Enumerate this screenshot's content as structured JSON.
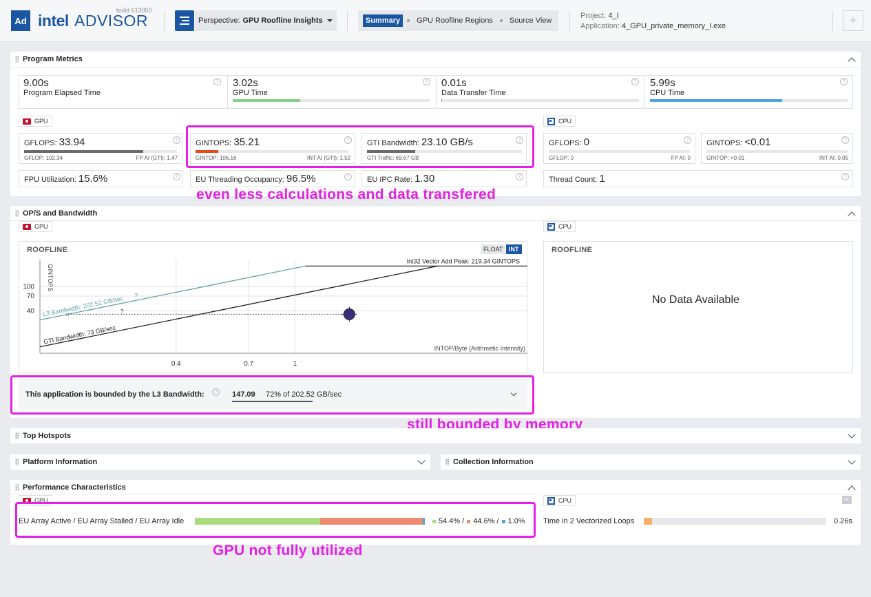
{
  "header": {
    "logo_badge": "Ad",
    "logo_brand": "intel",
    "logo_product": "ADVISOR",
    "build": "build 613050",
    "perspective_prefix": "Perspective:",
    "perspective_value": "GPU Roofline Insights",
    "tabs": [
      "Summary",
      "GPU Roofline Regions",
      "Source View"
    ],
    "project_label": "Project:",
    "project_value": "4_I",
    "application_label": "Application:",
    "application_value": "4_GPU_private_memory_I.exe",
    "add_button": "+"
  },
  "program_metrics": {
    "title": "Program Metrics",
    "top": [
      {
        "value": "9.00s",
        "label": "Program Elapsed Time",
        "fill": null,
        "color": null
      },
      {
        "value": "3.02s",
        "label": "GPU Time",
        "fill": 0.34,
        "color": "#8ad08a"
      },
      {
        "value": "0.01s",
        "label": "Data Transfer Time",
        "fill": 0.003,
        "color": "#e86a8a"
      },
      {
        "value": "5.99s",
        "label": "CPU Time",
        "fill": 0.67,
        "color": "#4ea6dc"
      }
    ],
    "gpu_chip": "GPU",
    "cpu_chip": "CPU",
    "gflops": {
      "label": "GFLOPS:",
      "value": "33.94",
      "sub_left": "GFLOP: 102.34",
      "sub_right": "FP AI (GTI): 1.47",
      "fill": 0.78
    },
    "gintops": {
      "label": "GINTOPS:",
      "value": "35.21",
      "sub_left": "GINTOP: 106.16",
      "sub_right": "INT AI (GTI): 1.52",
      "fill": 0.15
    },
    "gti": {
      "label": "GTI Bandwidth:",
      "value": "23.10 GB/s",
      "sub_left": "GTI Traffic: 69.67 GB",
      "fill": 0.31
    },
    "cpu_gflops": {
      "label": "GFLOPS:",
      "value": "0",
      "sub_left": "GFLOP: 0",
      "sub_right": "FP AI: 0"
    },
    "cpu_gintops": {
      "label": "GINTOPS:",
      "value": "<0.01",
      "sub_left": "GINTOP: <0.01",
      "sub_right": "INT AI: 0.05"
    },
    "fpu": {
      "label": "FPU Utilization:",
      "value": "15.6%"
    },
    "eu_occ": {
      "label": "EU Threading Occupancy:",
      "value": "96.5%"
    },
    "eu_ipc": {
      "label": "EU IPC Rate:",
      "value": "1.30"
    },
    "thread_count": {
      "label": "Thread Count:",
      "value": "1"
    }
  },
  "annotations": {
    "a1": "even less calculations and data transfered",
    "a2": "still bounded by memory",
    "a3": "GPU not fully utilized"
  },
  "ops_bandwidth": {
    "title": "OP/S and Bandwidth",
    "gpu_chip": "GPU",
    "cpu_chip": "CPU",
    "roofline_title": "ROOFLINE",
    "toggle_float": "FLOAT",
    "toggle_int": "INT",
    "cpu_roofline_title": "ROOFLINE",
    "no_data": "No Data Available",
    "bound_text": "This application is bounded by the L3 Bandwidth:",
    "bound_value": "147.09",
    "bound_pct": "72% of 202.52 GB/sec"
  },
  "chart_data": {
    "type": "scatter",
    "ylabel": "GINTOPS",
    "xlabel": "INTOP/Byte (Arithmetic Intensity)",
    "x_ticks": [
      "0.4",
      "0.7",
      "1"
    ],
    "y_ticks": [
      "100",
      "70",
      "40"
    ],
    "x_scale": "log",
    "y_scale": "log",
    "roofs": [
      {
        "name": "Int32 Vector Add Peak: 219.34 GINTOPS",
        "value": 219.34,
        "kind": "compute"
      },
      {
        "name": "L3 Bandwidth: 202.52 GB/sec",
        "value": 202.52,
        "kind": "memory"
      },
      {
        "name": "GTI Bandwidth: 73 GB/sec",
        "value": 73,
        "kind": "memory"
      }
    ],
    "points": [
      {
        "x": 1.52,
        "y": 35.21,
        "color": "#3b2d7a"
      }
    ],
    "roof_markers": [
      "?",
      "?"
    ]
  },
  "top_hotspots": {
    "title": "Top Hotspots"
  },
  "platform_info": {
    "title": "Platform Information"
  },
  "collection_info": {
    "title": "Collection Information"
  },
  "perf": {
    "title": "Performance Characteristics",
    "gpu_chip": "GPU",
    "cpu_chip": "CPU",
    "eu_label": "EU Array Active / EU Array Stalled / EU Array Idle",
    "eu_segments": [
      {
        "value": 54.4,
        "color": "#a8dc7e",
        "text": "54.4%"
      },
      {
        "value": 44.6,
        "color": "#f08a72",
        "text": "44.6%"
      },
      {
        "value": 1.0,
        "color": "#4ea6dc",
        "text": "1.0%"
      }
    ],
    "cpu_loop_label": "Time in 2 Vectorized Loops",
    "cpu_loop_value": "0.26s",
    "cpu_loop_fill": 0.045,
    "cpu_loop_color": "#f5b063"
  }
}
